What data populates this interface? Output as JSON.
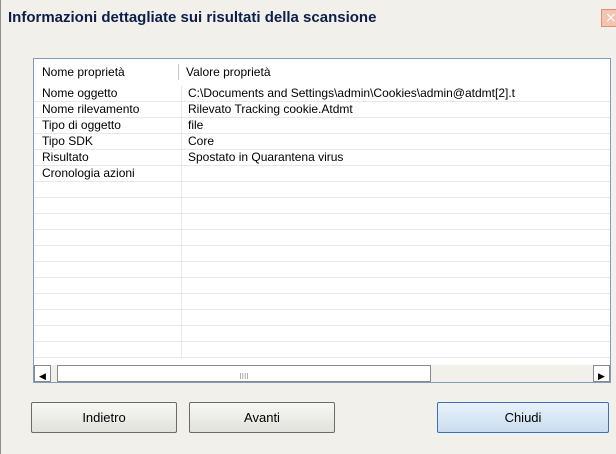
{
  "window": {
    "title": "Informazioni dettagliate sui risultati della scansione",
    "close_label": "×"
  },
  "table": {
    "columns": [
      "Nome proprietà",
      "Valore proprietà"
    ],
    "rows": [
      {
        "name": "Nome oggetto",
        "value": "C:\\Documents and Settings\\admin\\Cookies\\admin@atdmt[2].t"
      },
      {
        "name": "Nome rilevamento",
        "value": "Rilevato Tracking cookie.Atdmt"
      },
      {
        "name": "Tipo di oggetto",
        "value": "file"
      },
      {
        "name": "Tipo SDK",
        "value": "Core"
      },
      {
        "name": "Risultato",
        "value": "Spostato in Quarantena virus"
      },
      {
        "name": "Cronologia azioni",
        "value": ""
      },
      {
        "name": "",
        "value": ""
      },
      {
        "name": "",
        "value": ""
      },
      {
        "name": "",
        "value": ""
      },
      {
        "name": "",
        "value": ""
      },
      {
        "name": "",
        "value": ""
      },
      {
        "name": "",
        "value": ""
      },
      {
        "name": "",
        "value": ""
      },
      {
        "name": "",
        "value": ""
      },
      {
        "name": "",
        "value": ""
      },
      {
        "name": "",
        "value": ""
      },
      {
        "name": "",
        "value": ""
      }
    ]
  },
  "scrollbar": {
    "left_arrow": "◀",
    "right_arrow": "▶",
    "thumb_grip": "IIII"
  },
  "buttons": {
    "back": "Indietro",
    "next": "Avanti",
    "close": "Chiudi"
  }
}
